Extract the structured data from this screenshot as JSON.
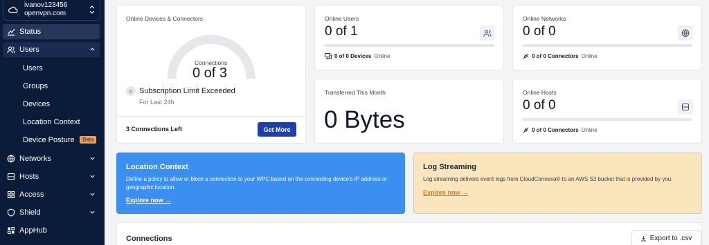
{
  "sidebar": {
    "org_name": "ivanov123456",
    "org_domain": "openvpn.com",
    "items": [
      {
        "label": "Status",
        "icon": "chart-icon"
      },
      {
        "label": "Users",
        "icon": "users-icon"
      },
      {
        "label": "Networks",
        "icon": "globe-icon"
      },
      {
        "label": "Hosts",
        "icon": "server-icon"
      },
      {
        "label": "Access",
        "icon": "grid-icon"
      },
      {
        "label": "Shield",
        "icon": "shield-icon"
      },
      {
        "label": "AppHub",
        "icon": "apps-icon"
      }
    ],
    "users_sub": [
      "Users",
      "Groups",
      "Devices",
      "Location Context",
      "Device Posture"
    ],
    "beta_badge": "Beta"
  },
  "devices_card": {
    "title": "Online Devices & Connectors",
    "gauge_label": "Connections",
    "gauge_value": "0 of 3",
    "badge": "0",
    "limit_text": "Subscription Limit Exceeded",
    "period": "For Last 24h",
    "connections_left": "3 Connections Left",
    "button": "Get More"
  },
  "online_users": {
    "title": "Online Users",
    "value": "0 of 1",
    "footer_bold": "0 of 0 Devices",
    "footer_muted": "Online"
  },
  "online_networks": {
    "title": "Online Networks",
    "value": "0 of 0",
    "footer_bold": "0 of 0 Connectors",
    "footer_muted": "Online"
  },
  "transferred": {
    "title": "Transferred This Month",
    "value": "0 Bytes"
  },
  "online_hosts": {
    "title": "Online Hosts",
    "value": "0 of 0",
    "footer_bold": "0 of 0 Connectors",
    "footer_muted": "Online"
  },
  "location_banner": {
    "title": "Location Context",
    "text": "Define a policy to allow or block a connection to your WPC based on the connecting device's IP address or geographic location.",
    "link": "Explore now"
  },
  "log_banner": {
    "title": "Log Streaming",
    "text": "Log streaming delivers event logs from CloudConnexa® to an AWS S3 bucket that is provided by you.",
    "link": "Explore now"
  },
  "connections": {
    "title": "Connections",
    "export": "Export to .csv"
  },
  "colors": {
    "sidebar_bg": "#0b1b3a",
    "primary_button": "#1e40af",
    "location_banner": "#3b8ff0",
    "log_banner": "#fae5bc",
    "beta_badge": "#f59e4b"
  }
}
